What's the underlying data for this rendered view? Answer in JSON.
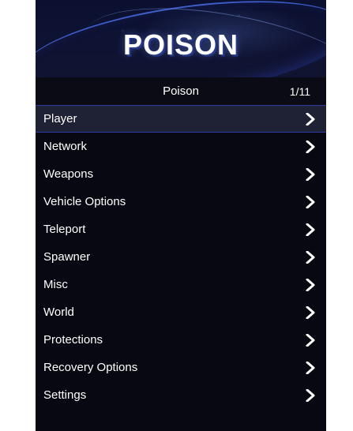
{
  "banner": {
    "title": "POISON"
  },
  "header": {
    "title": "Poison",
    "counter": "1/11"
  },
  "menu": {
    "items": [
      {
        "label": "Player",
        "icon": "chevron-right-icon"
      },
      {
        "label": "Network",
        "icon": "chevron-right-icon"
      },
      {
        "label": "Weapons",
        "icon": "chevron-right-icon"
      },
      {
        "label": "Vehicle Options",
        "icon": "chevron-right-icon"
      },
      {
        "label": "Teleport",
        "icon": "chevron-right-icon"
      },
      {
        "label": "Spawner",
        "icon": "chevron-right-icon"
      },
      {
        "label": "Misc",
        "icon": "chevron-right-icon"
      },
      {
        "label": "World",
        "icon": "chevron-right-icon"
      },
      {
        "label": "Protections",
        "icon": "chevron-right-icon"
      },
      {
        "label": "Recovery Options",
        "icon": "chevron-right-icon"
      },
      {
        "label": "Settings",
        "icon": "chevron-right-icon"
      }
    ]
  },
  "colors": {
    "panel_bg": "#070812",
    "active_row_bg": "#1f2134",
    "active_border": "#2f3aa5",
    "text": "#ffffff"
  }
}
